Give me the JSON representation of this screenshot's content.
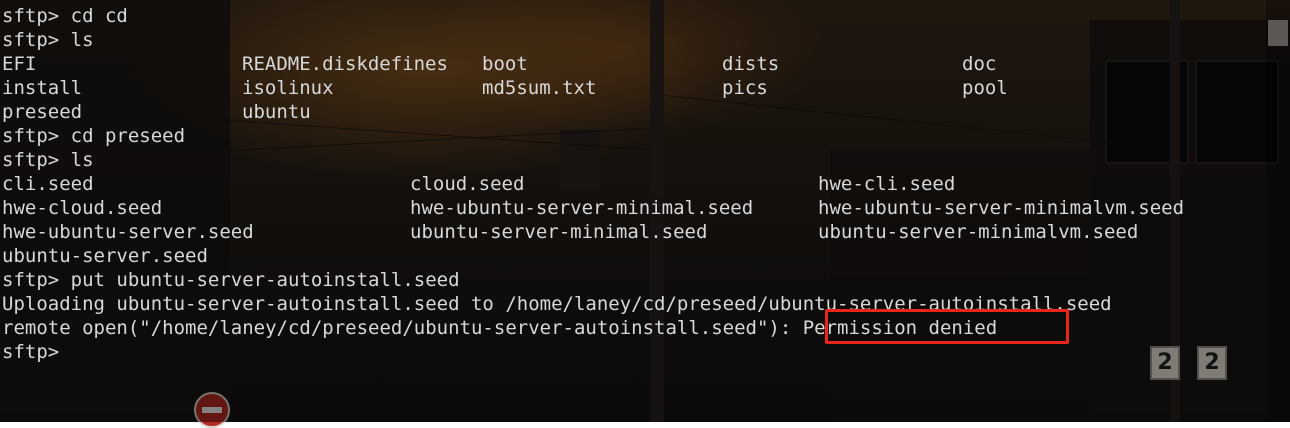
{
  "terminal": {
    "lines": [
      {
        "text": "sftp> cd cd"
      },
      {
        "text": "sftp> ls"
      },
      {
        "cols": [
          "EFI",
          "README.diskdefines",
          "boot",
          "dists",
          "doc"
        ]
      },
      {
        "cols": [
          "install",
          "isolinux",
          "md5sum.txt",
          "pics",
          "pool"
        ]
      },
      {
        "cols": [
          "preseed",
          "ubuntu"
        ]
      },
      {
        "text": "sftp> cd preseed"
      },
      {
        "text": "sftp> ls"
      },
      {
        "cols": [
          "cli.seed",
          "cloud.seed",
          "hwe-cli.seed"
        ]
      },
      {
        "cols": [
          "hwe-cloud.seed",
          "hwe-ubuntu-server-minimal.seed",
          "hwe-ubuntu-server-minimalvm.seed"
        ]
      },
      {
        "cols": [
          "hwe-ubuntu-server.seed",
          "ubuntu-server-minimal.seed",
          "ubuntu-server-minimalvm.seed"
        ]
      },
      {
        "text": "ubuntu-server.seed"
      },
      {
        "text": "sftp> put ubuntu-server-autoinstall.seed"
      },
      {
        "text": "Uploading ubuntu-server-autoinstall.seed to /home/laney/cd/preseed/ubuntu-server-autoinstall.seed"
      },
      {
        "text": "remote open(\"/home/laney/cd/preseed/ubuntu-server-autoinstall.seed\"): Permission denied"
      },
      {
        "text": "sftp> "
      }
    ]
  },
  "background": {
    "signs": [
      "2",
      "2"
    ]
  },
  "colors": {
    "text": "#d8d8d8",
    "highlight_border": "#e8261b"
  }
}
